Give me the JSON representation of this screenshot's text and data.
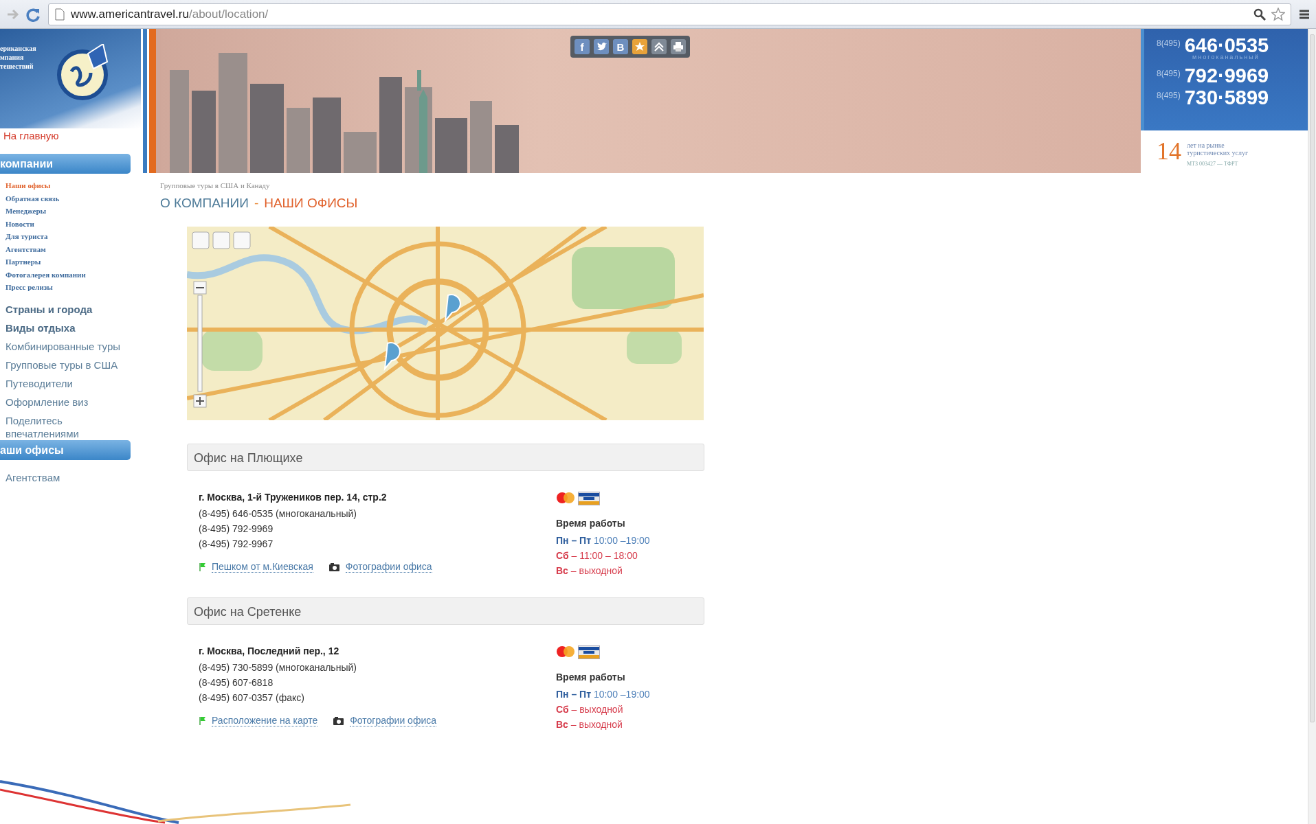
{
  "browser": {
    "url_host": "www.americantravel.ru",
    "url_path": "/about/location/"
  },
  "logo": {
    "lines": [
      "ериканская",
      "мпания",
      "тешествий"
    ]
  },
  "share_buttons": [
    {
      "kind": "facebook",
      "label": "f"
    },
    {
      "kind": "twitter"
    },
    {
      "kind": "vk",
      "label": "B"
    },
    {
      "kind": "bookmark"
    },
    {
      "kind": "up"
    },
    {
      "kind": "print"
    }
  ],
  "phones": [
    {
      "prefix": "8(495)",
      "number": "646·0535",
      "note": "многоканальный"
    },
    {
      "prefix": "8(495)",
      "number": "792·9969"
    },
    {
      "prefix": "8(495)",
      "number": "730·5899"
    }
  ],
  "years": {
    "number": "14",
    "text": "лет на рынке туристических услуг",
    "license": "МТЗ 003427 — ТФРТ"
  },
  "sidebar": {
    "items": [
      {
        "kind": "home",
        "label": "На главную"
      },
      {
        "kind": "section",
        "label": "компании"
      },
      {
        "kind": "sub",
        "label": "Наши офисы",
        "selected": true
      },
      {
        "kind": "sub",
        "label": "Обратная связь",
        "selected": false
      },
      {
        "kind": "sub",
        "label": "Менеджеры",
        "selected": false
      },
      {
        "kind": "sub",
        "label": "Новости",
        "selected": false
      },
      {
        "kind": "sub",
        "label": "Для туриста",
        "selected": false
      },
      {
        "kind": "sub",
        "label": "Агентствам",
        "selected": false
      },
      {
        "kind": "sub",
        "label": "Партнеры",
        "selected": false
      },
      {
        "kind": "sub",
        "label": "Фотогалерея компании",
        "selected": false
      },
      {
        "kind": "sub",
        "label": "Пресс релизы",
        "selected": false
      },
      {
        "kind": "bold",
        "label": "Страны и города"
      },
      {
        "kind": "bold",
        "label": "Виды отдыха"
      },
      {
        "kind": "plain",
        "label": "Комбинированные туры"
      },
      {
        "kind": "plain",
        "label": "Групповые туры в США"
      },
      {
        "kind": "plain",
        "label": "Путеводители"
      },
      {
        "kind": "plain",
        "label": "Оформление виз"
      },
      {
        "kind": "plain",
        "label": "Поделитесь впечатлениями"
      },
      {
        "kind": "section",
        "label": "аши офисы"
      },
      {
        "kind": "plain",
        "label": "Агентствам"
      }
    ]
  },
  "breadcrumb": "Групповые туры в США и Канаду",
  "title": {
    "section": "О КОМПАНИИ",
    "separator": "-",
    "page": "НАШИ ОФИСЫ"
  },
  "offices": [
    {
      "name": "Офис на Плющихе",
      "address": "г. Москва, 1-й Тружеников пер. 14, стр.2",
      "phones": [
        "(8-495) 646-0535 (многоканальный)",
        "(8-495) 792-9969",
        "(8-495) 792-9967"
      ],
      "links": [
        {
          "kind": "flag",
          "label": "Пешком от м.Киевская"
        },
        {
          "kind": "camera",
          "label": "Фотографии офиса"
        }
      ],
      "hours_title": "Время работы",
      "hours": [
        {
          "kind": "weekday",
          "text": "**Пн – Пт** 10:00 –19:00"
        },
        {
          "kind": "weekend",
          "text": "**Сб** – 11:00 – 18:00"
        },
        {
          "kind": "weekend",
          "text": "**Вс** – выходной"
        }
      ]
    },
    {
      "name": "Офис на Сретенке",
      "address": "г. Москва, Последний пер., 12",
      "phones": [
        "(8-495) 730-5899 (многоканальный)",
        "(8-495) 607-6818",
        "(8-495) 607-0357 (факс)"
      ],
      "links": [
        {
          "kind": "flag",
          "label": "Расположение на карте"
        },
        {
          "kind": "camera",
          "label": "Фотографии офиса"
        }
      ],
      "hours_title": "Время работы",
      "hours": [
        {
          "kind": "weekday",
          "text": "**Пн – Пт** 10:00 –19:00"
        },
        {
          "kind": "weekend",
          "text": "**Сб** – выходной"
        },
        {
          "kind": "weekend",
          "text": "**Вс** – выходной"
        }
      ]
    }
  ]
}
